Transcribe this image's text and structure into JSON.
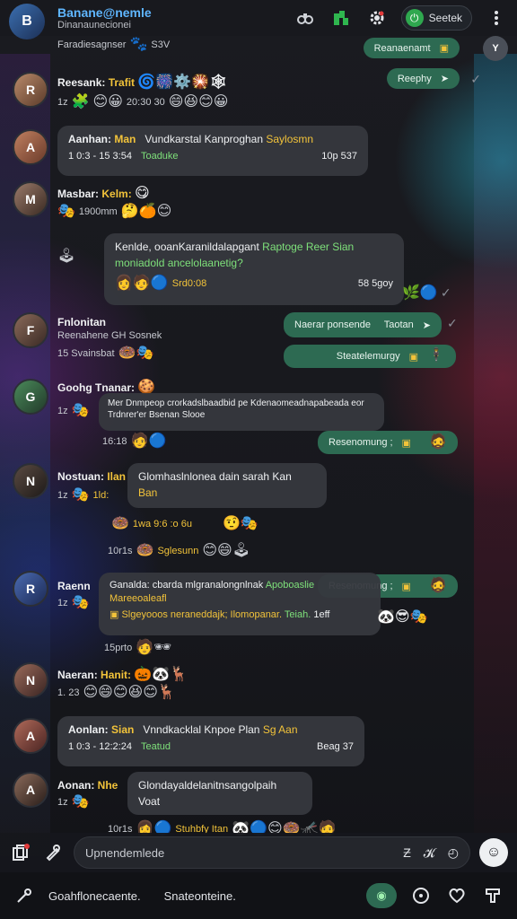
{
  "header": {
    "title": "Banane@nemle",
    "subtitle": "Dinanaunecionei",
    "search_label": "Seetek",
    "icons": [
      "binoculars-icon",
      "green-block-icon",
      "gear-icon",
      "search-toggle-icon",
      "more-vert-icon"
    ]
  },
  "messages": [
    {
      "id": "m0",
      "meta": "Faradiesagnser",
      "time": "S3V",
      "out_text": "Reanaenamt"
    },
    {
      "id": "m1",
      "sender": "Reesank:",
      "highlight": "Trafit",
      "meta_prefix": "1z",
      "reactions_text": "20:30 30",
      "out_text": "Reephy"
    },
    {
      "id": "m2",
      "sender": "Aanhan:",
      "highlight": "Man",
      "text": "Vundkarstal Kanproghan",
      "tag": "Saylosmn",
      "sub_left": "1 0:3 - 15 3:54",
      "sub_mid": "Toaduke",
      "time": "10p 537"
    },
    {
      "id": "m3",
      "sender": "Masbar:",
      "highlight": "Kelm:",
      "meta": "1900mm",
      "text_a": "Kenlde, ooanKaranildalapgant",
      "text_a_green": "Raptoge Reer Sian",
      "text_b_green": "moniadold ancelolaanetig?",
      "react_tag": "Srd0:08",
      "time": "58 5goy"
    },
    {
      "id": "m4",
      "sender": "Fnlonitan",
      "subline": "Reenahene GH Sosnek",
      "meta": "15 Svainsbat",
      "out_a": "Naerar ponsende",
      "out_a_tag": "Taotan",
      "out_b": "Steatelemurgy"
    },
    {
      "id": "m5",
      "sender": "Goohg Tnanar:",
      "text": "Mer Dnmpeop crorkadslbaadbid pe Kdenaomeadnapabeada eor Trdnrer'er Bsenan",
      "text_tag": "Slooe",
      "meta_prefix": "1z",
      "time": "16:18",
      "out_text": "Resenomung ;"
    },
    {
      "id": "m6",
      "sender": "Nostuan:",
      "highlight": "Ilan",
      "meta_prefix": "1z",
      "hl2": "1ld:",
      "text": "Glomhaslnlonea dain sarah Kan",
      "text_tag": "Ban",
      "inner_meta": "1wa 9:6 :o 6u",
      "time": "10r1s",
      "react_tag": "Sglesunn",
      "out_text": "Resenomung ;"
    },
    {
      "id": "m7",
      "sender": "Raenn",
      "meta_prefix": "1z",
      "text": "Ganalda: cbarda mlgranalongnlnak",
      "text_green": "Apoboaslie",
      "text_b": "Mareeoaleafl",
      "line3_a": "Slgeyooos neraneddajk; Ilomopanar.",
      "line3_b": "Teiah.",
      "line3_c": "1eff",
      "time": "15prto"
    },
    {
      "id": "m8",
      "sender": "Naeran:",
      "highlight": "Hanit:",
      "meta": "1. 23"
    },
    {
      "id": "m9",
      "sender": "Aonlan:",
      "highlight": "Sian",
      "text": "Vnndkacklal Knpoe Plan",
      "tag": "Sg Aan",
      "sub_left": "1 0:3 - 12:2:24",
      "sub_mid": "Teatud",
      "time": "Beag 37"
    },
    {
      "id": "m10",
      "sender": "Aonan:",
      "highlight": "Nhe",
      "text": "Glondayaldelanitnsangolpaih",
      "text_b": "Voat",
      "meta_prefix": "1z",
      "time": "10r1s",
      "react_tag": "Stuhbfy Itan"
    }
  ],
  "composer": {
    "placeholder": "Upnendemlede",
    "icons": [
      "mention-icon",
      "translate-icon",
      "clock-icon",
      "emoji-icon"
    ]
  },
  "bottombar": {
    "left_label": "Goahflonecaente.",
    "mid_label": "Snateonteine.",
    "icons": [
      "pen-icon",
      "play-icon",
      "info-icon",
      "heart-icon",
      "flag-icon"
    ]
  },
  "colors": {
    "accent_green": "#2d6a52",
    "bubble": "#36383e",
    "highlight_yellow": "#f2c33a",
    "green_text": "#7ee07a",
    "title_blue": "#5fb6ff"
  }
}
